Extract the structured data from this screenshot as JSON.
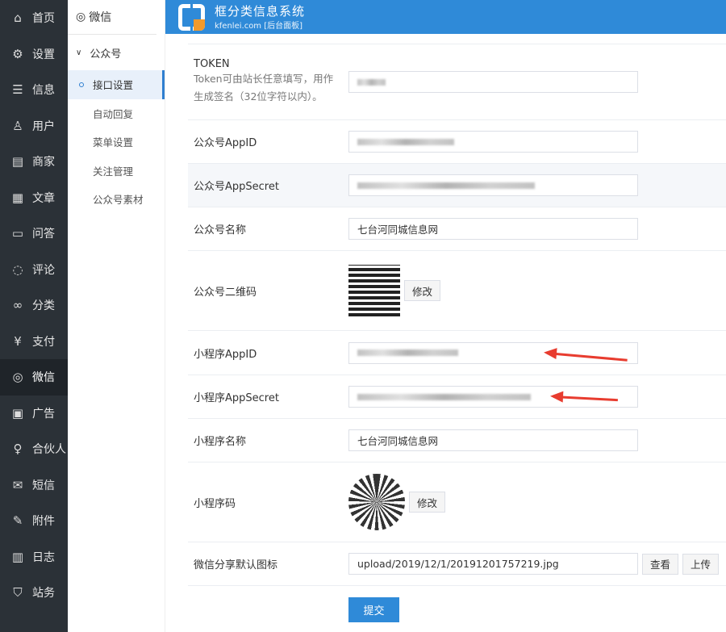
{
  "nav": [
    {
      "label": "首页",
      "icon": "⌂"
    },
    {
      "label": "设置",
      "icon": "⚙"
    },
    {
      "label": "信息",
      "icon": "☰"
    },
    {
      "label": "用户",
      "icon": "♙"
    },
    {
      "label": "商家",
      "icon": "▤"
    },
    {
      "label": "文章",
      "icon": "▦"
    },
    {
      "label": "问答",
      "icon": "▭"
    },
    {
      "label": "评论",
      "icon": "◌"
    },
    {
      "label": "分类",
      "icon": "∞"
    },
    {
      "label": "支付",
      "icon": "¥"
    },
    {
      "label": "微信",
      "icon": "◎"
    },
    {
      "label": "广告",
      "icon": "▣"
    },
    {
      "label": "合伙人",
      "icon": "♀"
    },
    {
      "label": "短信",
      "icon": "✉"
    },
    {
      "label": "附件",
      "icon": "✎"
    },
    {
      "label": "日志",
      "icon": "▥"
    },
    {
      "label": "站务",
      "icon": "⛉"
    }
  ],
  "subnav": {
    "header": "微信",
    "group": "公众号",
    "items": [
      "接口设置",
      "自动回复",
      "菜单设置",
      "关注管理",
      "公众号素材"
    ]
  },
  "header": {
    "title": "框分类信息系统",
    "subtitle": "kfenlei.com [后台面板]"
  },
  "form": {
    "token_label": "TOKEN",
    "token_hint": "Token可由站长任意填写，用作生成签名（32位字符以内）。",
    "mp_appid_label": "公众号AppID",
    "mp_secret_label": "公众号AppSecret",
    "mp_name_label": "公众号名称",
    "mp_name": "七台河同城信息网",
    "mp_qr_label": "公众号二维码",
    "modify": "修改",
    "mini_appid_label": "小程序AppID",
    "mini_secret_label": "小程序AppSecret",
    "mini_name_label": "小程序名称",
    "mini_name": "七台河同城信息网",
    "mini_code_label": "小程序码",
    "share_icon_label": "微信分享默认图标",
    "share_icon": "upload/2019/12/1/20191201757219.jpg",
    "view": "查看",
    "upload": "上传",
    "submit": "提交"
  }
}
